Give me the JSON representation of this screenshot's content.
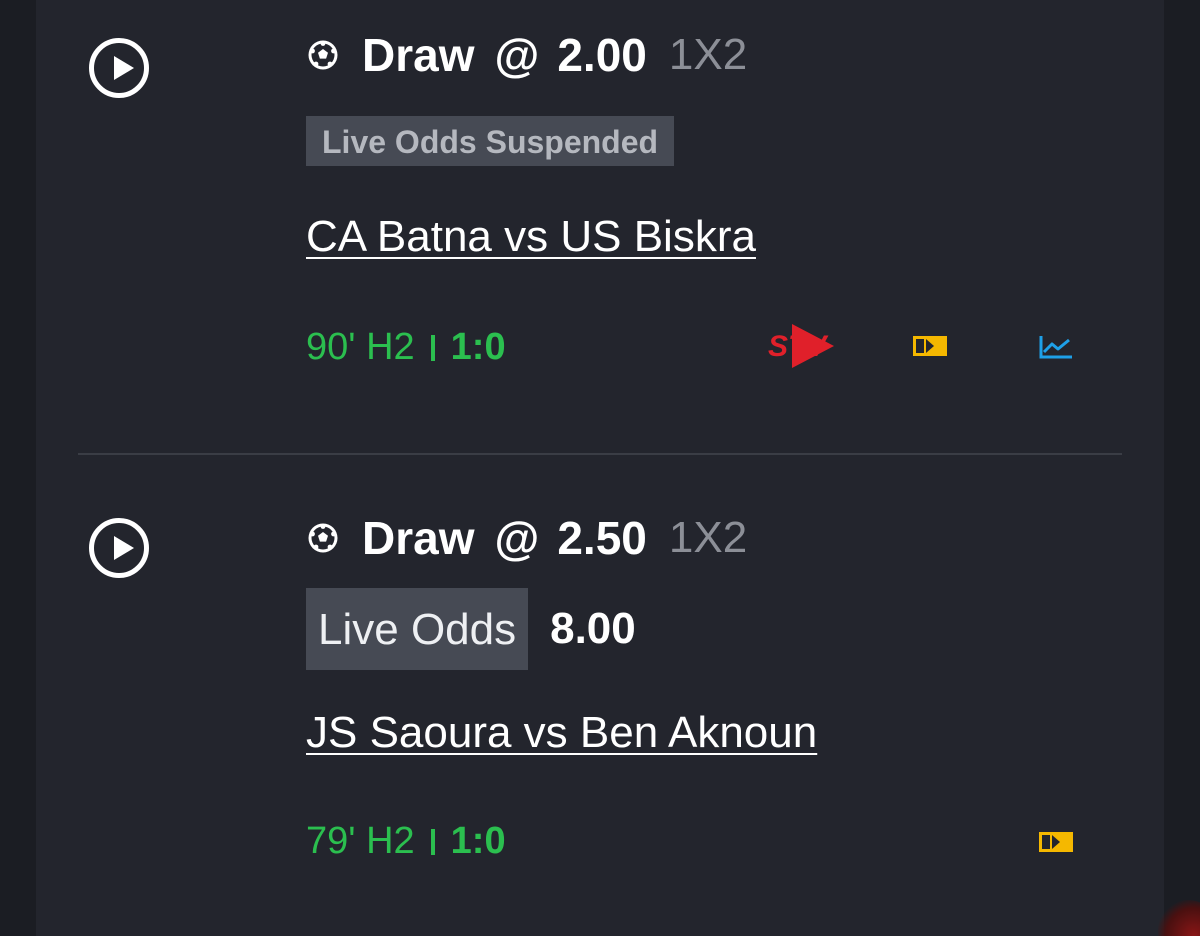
{
  "bets": [
    {
      "pick": "Draw",
      "at": "@",
      "odds": "2.00",
      "market": "1X2",
      "odds_status": "Live Odds Suspended",
      "match": "CA Batna vs US Biskra",
      "time": "90' H2",
      "score": "1:0",
      "icons": [
        "stv-icon",
        "scoreboard-icon",
        "stats-icon"
      ]
    },
    {
      "pick": "Draw",
      "at": "@",
      "odds": "2.50",
      "market": "1X2",
      "live_odds_label": "Live Odds",
      "live_odds_value": "8.00",
      "match": "JS Saoura vs Ben Aknoun",
      "time": "79' H2",
      "score": "1:0",
      "icons": [
        "scoreboard-icon"
      ]
    }
  ],
  "stv_logo": {
    "text": "STV"
  },
  "colors": {
    "background": "#1b1d23",
    "panel": "#23252d",
    "live_green": "#2bbf4f",
    "scoreboard_yellow": "#f5b800",
    "stats_blue": "#1ea0e8",
    "stv_red": "#e0202a",
    "badge_bg": "#464a54"
  }
}
